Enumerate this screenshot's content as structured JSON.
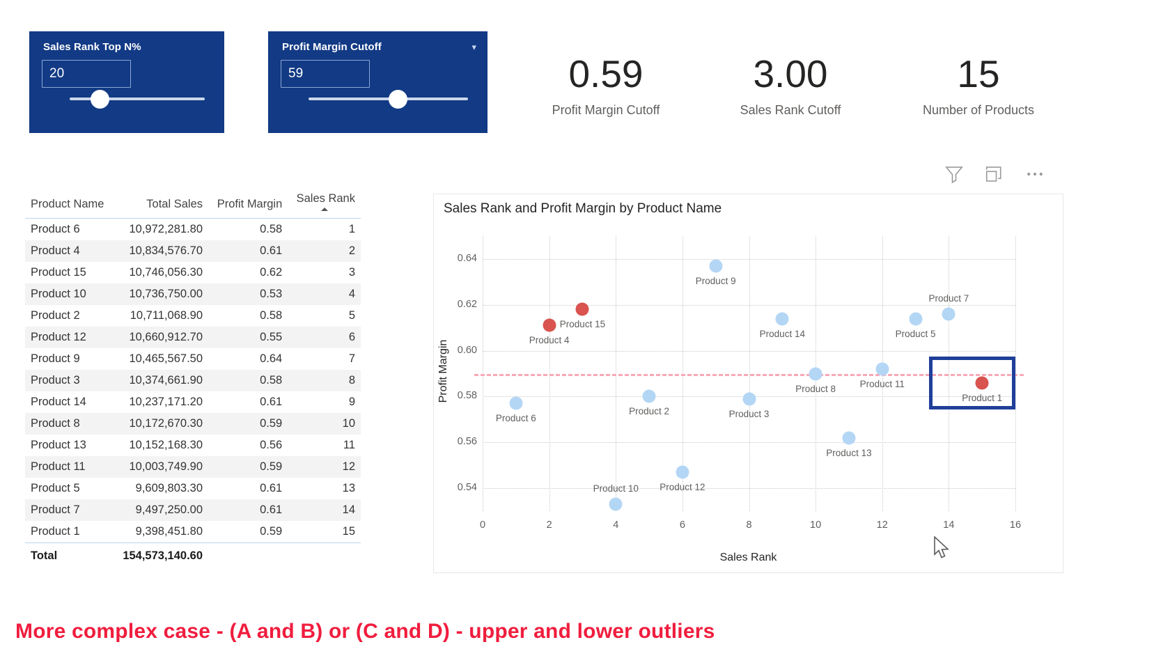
{
  "slicers": [
    {
      "name": "sales-rank-top-n",
      "title": "Sales Rank Top N%",
      "value": "20",
      "placeholder": "",
      "thumb_pct": 20
    },
    {
      "name": "profit-margin-cutoff",
      "title": "Profit Margin Cutoff",
      "value": "59",
      "placeholder": "",
      "thumb_pct": 59
    }
  ],
  "kpis": [
    {
      "value": "0.59",
      "label": "Profit Margin Cutoff"
    },
    {
      "value": "3.00",
      "label": "Sales Rank Cutoff"
    },
    {
      "value": "15",
      "label": "Number of Products"
    }
  ],
  "table": {
    "columns": [
      "Product Name",
      "Total Sales",
      "Profit Margin",
      "Sales Rank"
    ],
    "sorted_column": "Sales Rank",
    "sort_direction": "ascending",
    "rows": [
      [
        "Product 6",
        "10,972,281.80",
        "0.58",
        "1"
      ],
      [
        "Product 4",
        "10,834,576.70",
        "0.61",
        "2"
      ],
      [
        "Product 15",
        "10,746,056.30",
        "0.62",
        "3"
      ],
      [
        "Product 10",
        "10,736,750.00",
        "0.53",
        "4"
      ],
      [
        "Product 2",
        "10,711,068.90",
        "0.58",
        "5"
      ],
      [
        "Product 12",
        "10,660,912.70",
        "0.55",
        "6"
      ],
      [
        "Product 9",
        "10,465,567.50",
        "0.64",
        "7"
      ],
      [
        "Product 3",
        "10,374,661.90",
        "0.58",
        "8"
      ],
      [
        "Product 14",
        "10,237,171.20",
        "0.61",
        "9"
      ],
      [
        "Product 8",
        "10,172,670.30",
        "0.59",
        "10"
      ],
      [
        "Product 13",
        "10,152,168.30",
        "0.56",
        "11"
      ],
      [
        "Product 11",
        "10,003,749.90",
        "0.59",
        "12"
      ],
      [
        "Product 5",
        "9,609,803.30",
        "0.61",
        "13"
      ],
      [
        "Product 7",
        "9,497,250.00",
        "0.61",
        "14"
      ],
      [
        "Product 1",
        "9,398,451.80",
        "0.59",
        "15"
      ]
    ],
    "total_row": [
      "Total",
      "154,573,140.60",
      "",
      ""
    ]
  },
  "chart_toolbar": {
    "filter_icon": "filter-icon",
    "focus_icon": "focus-mode-icon",
    "more_icon": "more-options-icon"
  },
  "chart_data": {
    "type": "scatter",
    "title": "Sales Rank and Profit Margin by Product Name",
    "xlabel": "Sales Rank",
    "ylabel": "Profit Margin",
    "xlim": [
      0,
      16
    ],
    "ylim": [
      0.53,
      0.65
    ],
    "xticks": [
      0,
      2,
      4,
      6,
      8,
      10,
      12,
      14,
      16
    ],
    "yticks": [
      0.54,
      0.56,
      0.58,
      0.6,
      0.62,
      0.64
    ],
    "ytick_labels": [
      "0.54",
      "0.56",
      "0.58",
      "0.60",
      "0.62",
      "0.64"
    ],
    "grid": true,
    "legend": "none",
    "reference_line": {
      "name": "profit-margin-cutoff-line",
      "axis": "y",
      "value": 0.59,
      "color": "#f9a8b8",
      "style": "dashed"
    },
    "colors": {
      "normal": "#b4d6f5",
      "highlight": "#d9534f",
      "selection_box": "#1f3f99"
    },
    "points": [
      {
        "label": "Product 6",
        "x": 1,
        "y": 0.577,
        "color": "normal",
        "label_pos": "below"
      },
      {
        "label": "Product 4",
        "x": 2,
        "y": 0.611,
        "color": "highlight",
        "label_pos": "below"
      },
      {
        "label": "Product 15",
        "x": 3,
        "y": 0.618,
        "color": "highlight",
        "label_pos": "below"
      },
      {
        "label": "Product 10",
        "x": 4,
        "y": 0.533,
        "color": "normal",
        "label_pos": "above"
      },
      {
        "label": "Product 2",
        "x": 5,
        "y": 0.58,
        "color": "normal",
        "label_pos": "below"
      },
      {
        "label": "Product 12",
        "x": 6,
        "y": 0.547,
        "color": "normal",
        "label_pos": "below"
      },
      {
        "label": "Product 9",
        "x": 7,
        "y": 0.637,
        "color": "normal",
        "label_pos": "below"
      },
      {
        "label": "Product 3",
        "x": 8,
        "y": 0.579,
        "color": "normal",
        "label_pos": "below"
      },
      {
        "label": "Product 14",
        "x": 9,
        "y": 0.614,
        "color": "normal",
        "label_pos": "below"
      },
      {
        "label": "Product 8",
        "x": 10,
        "y": 0.59,
        "color": "normal",
        "label_pos": "below"
      },
      {
        "label": "Product 13",
        "x": 11,
        "y": 0.562,
        "color": "normal",
        "label_pos": "below"
      },
      {
        "label": "Product 11",
        "x": 12,
        "y": 0.592,
        "color": "normal",
        "label_pos": "below"
      },
      {
        "label": "Product 5",
        "x": 13,
        "y": 0.614,
        "color": "normal",
        "label_pos": "below"
      },
      {
        "label": "Product 7",
        "x": 14,
        "y": 0.616,
        "color": "normal",
        "label_pos": "above"
      },
      {
        "label": "Product 1",
        "x": 15,
        "y": 0.586,
        "color": "highlight",
        "label_pos": "below"
      }
    ],
    "selection_box": {
      "x0": 13.4,
      "x1": 16.0,
      "y0": 0.5745,
      "y1": 0.5975
    }
  },
  "caption": "More complex case - (A and B) or (C and D) - upper and lower outliers"
}
